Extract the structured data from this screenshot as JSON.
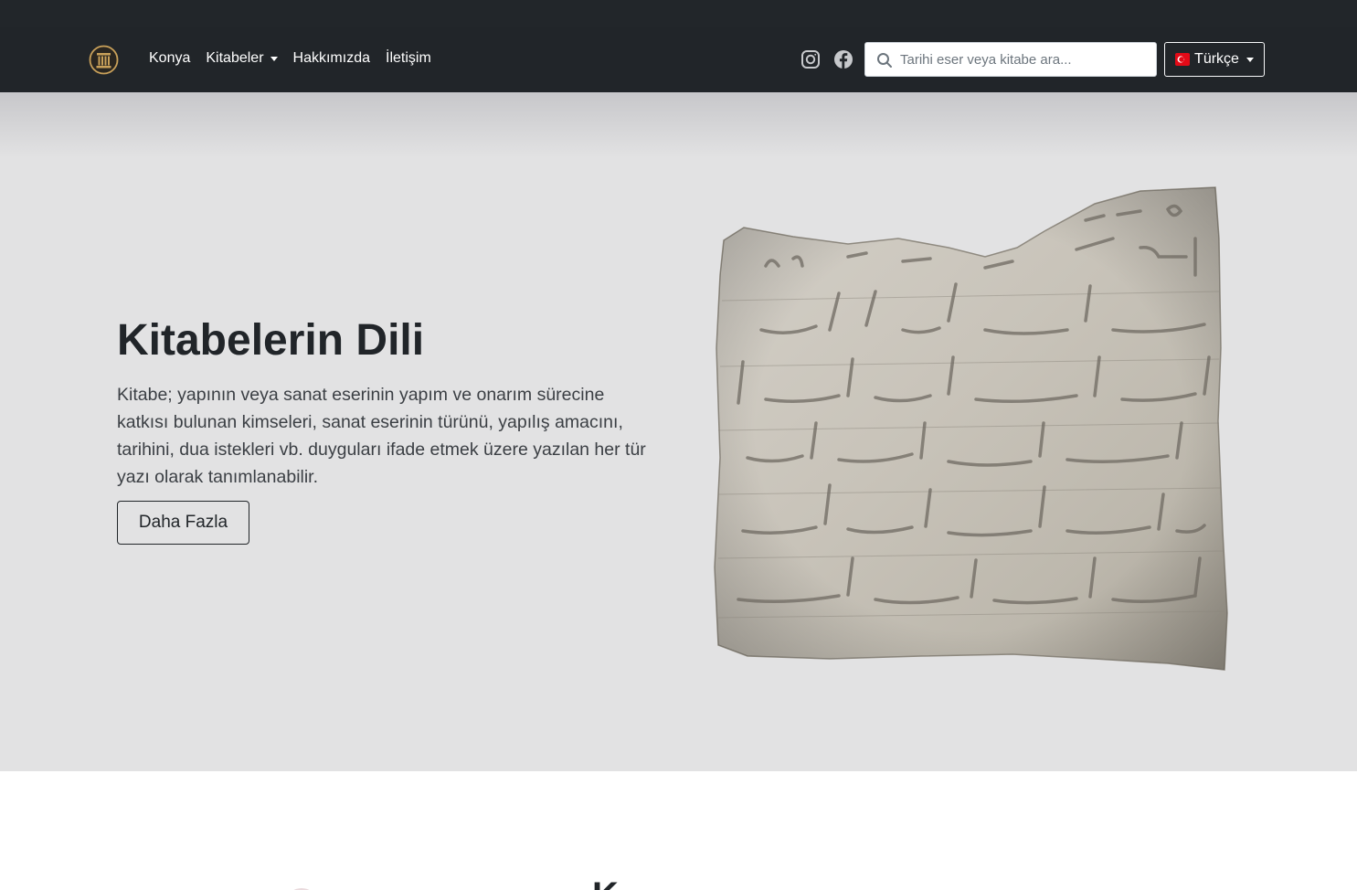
{
  "navbar": {
    "brand": {
      "icon": "column-logo-icon"
    },
    "links": [
      {
        "label": "Konya",
        "dropdown": false
      },
      {
        "label": "Kitabeler",
        "dropdown": true
      },
      {
        "label": "Hakkımızda",
        "dropdown": false
      },
      {
        "label": "İletişim",
        "dropdown": false
      }
    ],
    "social": [
      {
        "icon": "instagram-icon"
      },
      {
        "icon": "facebook-icon"
      }
    ],
    "search": {
      "placeholder": "Tarihi eser veya kitabe ara...",
      "value": "",
      "icon": "search-icon"
    },
    "language": {
      "label": "Türkçe",
      "flag": "turkey-flag-icon"
    }
  },
  "hero": {
    "title": "Kitabelerin Dili",
    "description": "Kitabe; yapının veya sanat eserinin yapım ve onarım sürecine katkısı bulunan kimseleri, sanat eserinin türünü, yapılış amacını, tarihini, dua istekleri vb. duyguları ifade etmek üzere yazılan her tür yazı olarak tanımlanabilir.",
    "button_label": "Daha Fazla",
    "image": "stone-inscription-image"
  },
  "next_section": {
    "heading_partial": "K"
  },
  "colors": {
    "navbar_bg": "#212529",
    "hero_bg": "#e2e2e3",
    "text": "#212529",
    "brand_gold": "#c9a15a",
    "flag_red": "#e30a17"
  }
}
